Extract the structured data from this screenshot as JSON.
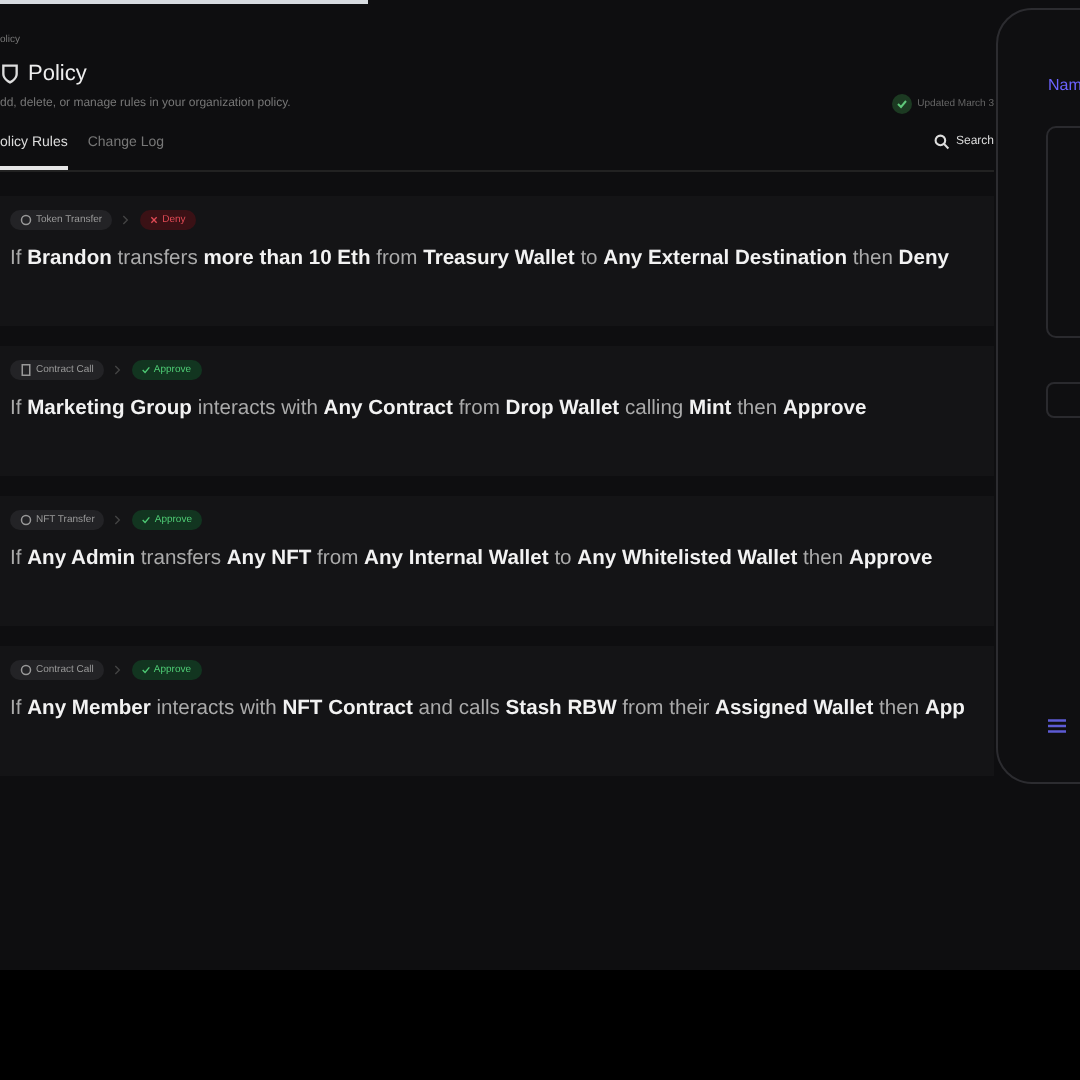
{
  "progress": {
    "level": 0.34
  },
  "breadcrumb": "olicy",
  "header": {
    "title": "Policy",
    "subtitle": "dd, delete, or manage rules in your organization policy.",
    "status": "Updated March 3"
  },
  "tabs": [
    {
      "label": "olicy Rules",
      "selected": true
    },
    {
      "label": "Change Log",
      "selected": false
    }
  ],
  "search": {
    "label": "Search"
  },
  "rules": [
    {
      "category": {
        "label": "Token Transfer",
        "kind": "token"
      },
      "action": {
        "label": "Deny",
        "kind": "deny"
      },
      "text": "If **Brandon** transfers **more than 10 Eth** from **Treasury Wallet** to **Any External Destination** then **Deny**"
    },
    {
      "category": {
        "label": "Contract Call",
        "kind": "contract"
      },
      "action": {
        "label": "Approve",
        "kind": "approve"
      },
      "text": "If **Marketing Group** interacts with **Any Contract** from **Drop Wallet** calling **Mint** then **Approve**"
    },
    {
      "category": {
        "label": "NFT Transfer",
        "kind": "token"
      },
      "action": {
        "label": "Approve",
        "kind": "approve"
      },
      "text": "If **Any Admin** transfers **Any NFT** from **Any Internal Wallet** to **Any Whitelisted Wallet** then **Approve**"
    },
    {
      "category": {
        "label": "Contract Call",
        "kind": "token"
      },
      "action": {
        "label": "Approve",
        "kind": "approve"
      },
      "text": "If **Any Member** interacts with **NFT Contract** and calls **Stash RBW** from their **Assigned Wallet** then **App**"
    }
  ],
  "panel": {
    "heading": "Nam"
  }
}
